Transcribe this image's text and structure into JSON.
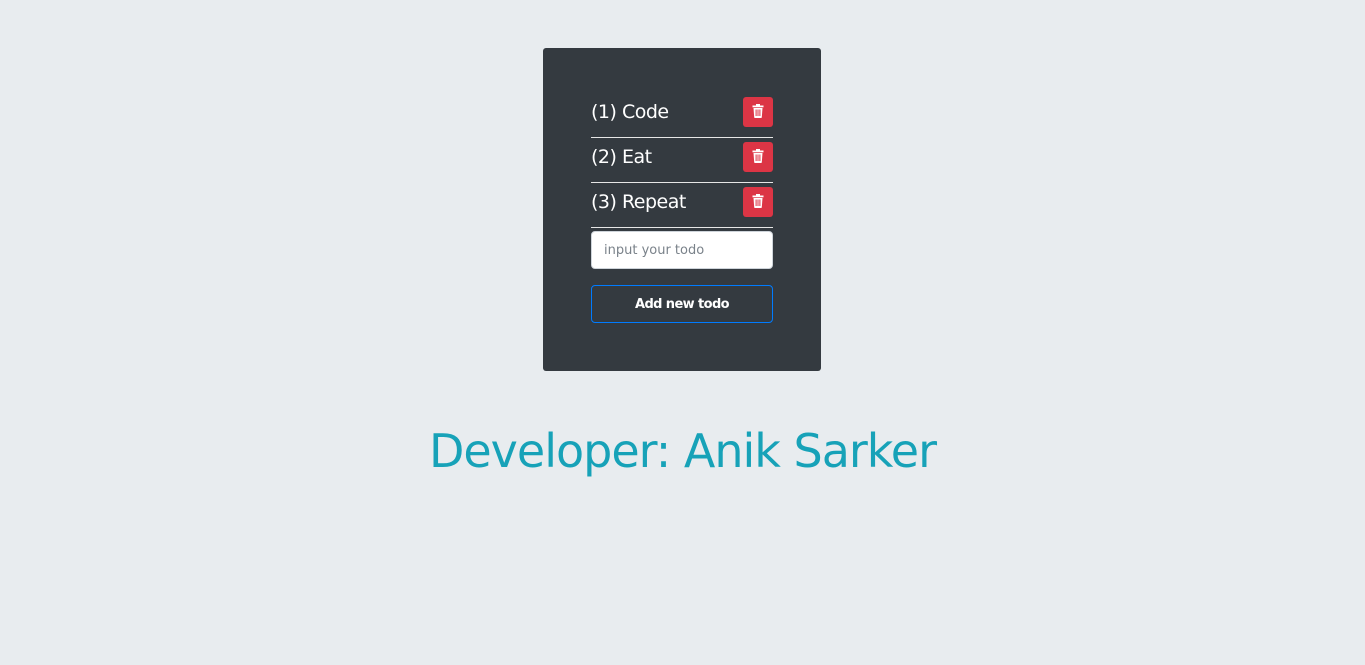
{
  "todos": {
    "items": [
      {
        "label": "(1) Code",
        "delete_icon": "trash-icon"
      },
      {
        "label": "(2) Eat",
        "delete_icon": "trash-icon"
      },
      {
        "label": "(3) Repeat",
        "delete_icon": "trash-icon"
      }
    ],
    "input": {
      "placeholder": "input your todo",
      "value": ""
    },
    "add_button_label": "Add new todo"
  },
  "footer": {
    "developer_text": "Developer: Anik Sarker"
  },
  "colors": {
    "background": "#e8ecef",
    "card": "#343a40",
    "delete_button": "#dc3545",
    "add_button_border": "#007bff",
    "developer_text": "#17a2b8"
  }
}
